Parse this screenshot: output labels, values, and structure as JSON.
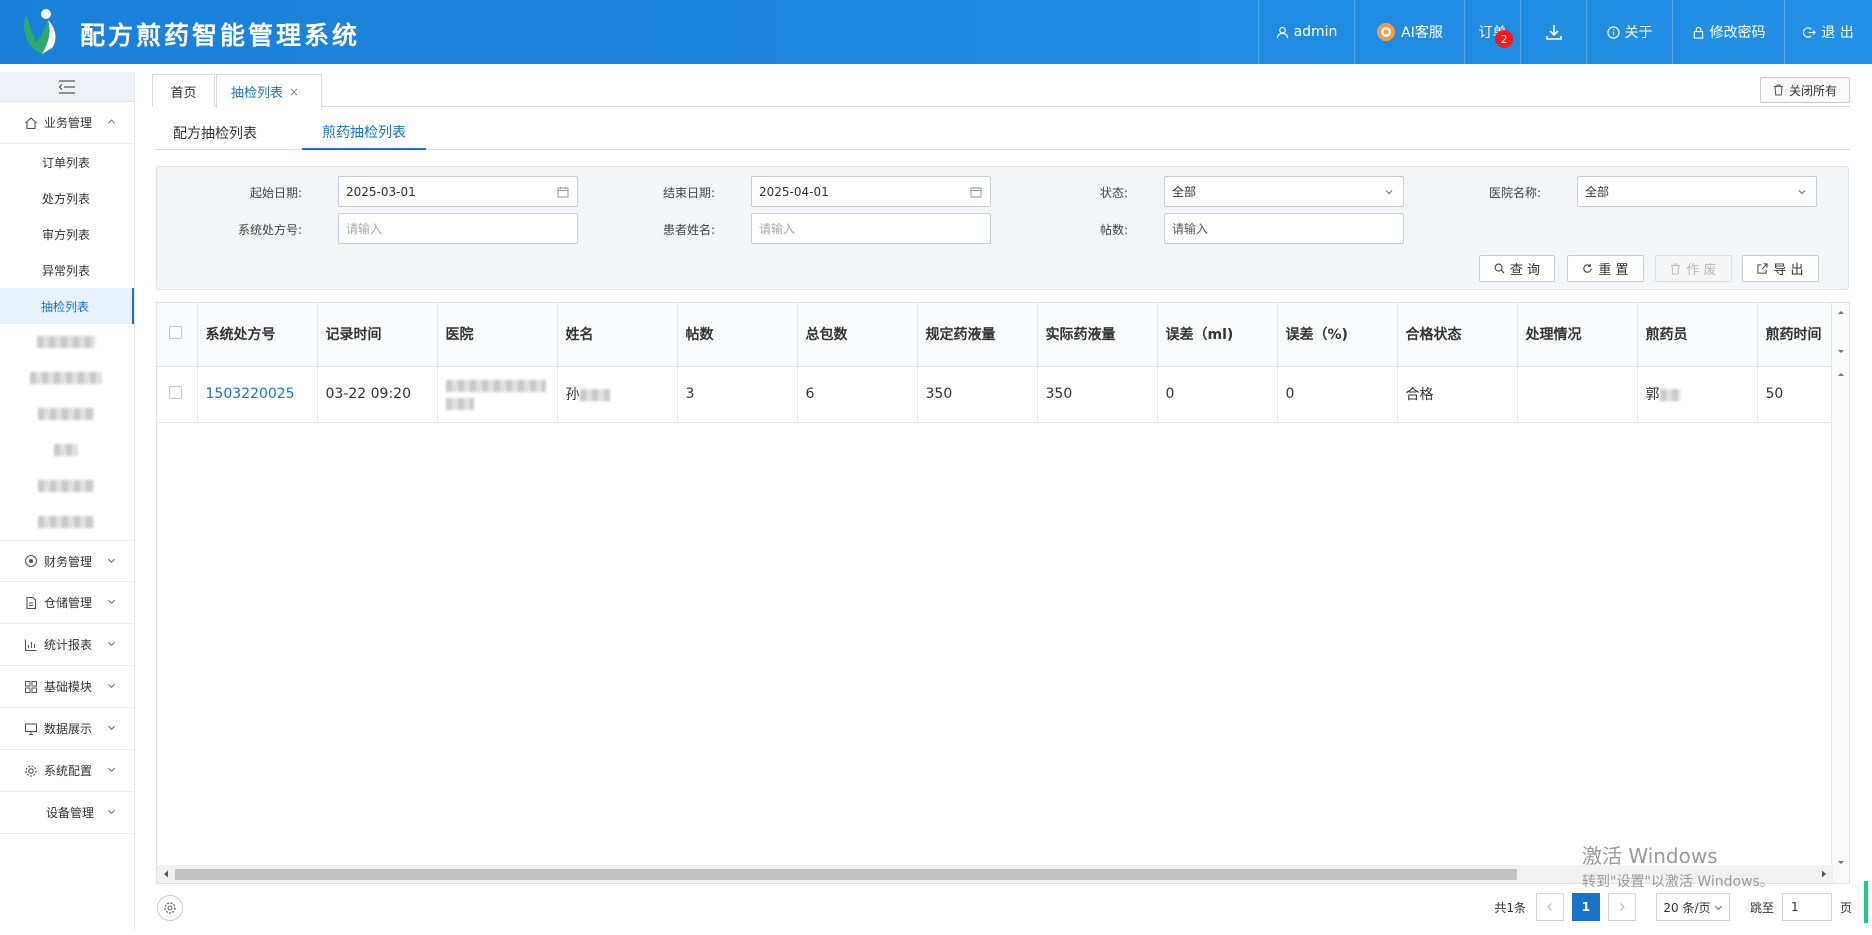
{
  "app": {
    "title": "配方煎药智能管理系统"
  },
  "header_nav": {
    "user": "admin",
    "ai_service": "AI客服",
    "orders": "订单",
    "orders_badge": "2",
    "about": "关于",
    "change_password": "修改密码",
    "logout": "退 出"
  },
  "sidebar": {
    "groups": [
      {
        "label": "业务管理",
        "icon": "home-icon",
        "expanded": true
      },
      {
        "label": "财务管理",
        "icon": "finance-icon"
      },
      {
        "label": "仓储管理",
        "icon": "storage-icon"
      },
      {
        "label": "统计报表",
        "icon": "chart-icon"
      },
      {
        "label": "基础模块",
        "icon": "module-icon"
      },
      {
        "label": "数据展示",
        "icon": "monitor-icon"
      },
      {
        "label": "系统配置",
        "icon": "gear-icon"
      },
      {
        "label": "设备管理",
        "icon": ""
      }
    ],
    "items": [
      {
        "label": "订单列表"
      },
      {
        "label": "处方列表"
      },
      {
        "label": "审方列表"
      },
      {
        "label": "异常列表"
      },
      {
        "label": "抽检列表",
        "active": true
      }
    ]
  },
  "page_tabs": [
    {
      "label": "首页"
    },
    {
      "label": "抽检列表",
      "active": true,
      "close": "×"
    }
  ],
  "close_all": "关闭所有",
  "sub_tabs": [
    {
      "label": "配方抽检列表"
    },
    {
      "label": "煎药抽检列表",
      "active": true
    }
  ],
  "filters": {
    "start_date": {
      "label": "起始日期:",
      "value": "2025-03-01"
    },
    "end_date": {
      "label": "结束日期:",
      "value": "2025-04-01"
    },
    "status": {
      "label": "状态:",
      "value": "全部"
    },
    "hospital": {
      "label": "医院名称:",
      "value": "全部"
    },
    "rx_no": {
      "label": "系统处方号:",
      "placeholder": "请输入"
    },
    "patient": {
      "label": "患者姓名:",
      "placeholder": "请输入"
    },
    "doses": {
      "label": "帖数:",
      "placeholder": "请输入"
    }
  },
  "buttons": {
    "search": "查 询",
    "reset": "重 置",
    "void": "作 废",
    "export": "导 出"
  },
  "table": {
    "columns": [
      "系统处方号",
      "记录时间",
      "医院",
      "姓名",
      "帖数",
      "总包数",
      "规定药液量",
      "实际药液量",
      "误差（ml)",
      "误差（%)",
      "合格状态",
      "处理情况",
      "煎药员",
      "煎药时间"
    ],
    "rows": [
      {
        "rx_no": "1503220025",
        "time": "03-22 09:20",
        "name_prefix": "孙",
        "doses": "3",
        "packs": "6",
        "required": "350",
        "actual": "350",
        "err_ml": "0",
        "err_pct": "0",
        "status": "合格",
        "handling": "",
        "staff_prefix": "郭",
        "decoct_time": "50"
      }
    ]
  },
  "pager": {
    "total": "共1条",
    "current": "1",
    "size": "20 条/页",
    "jump_label": "跳至",
    "jump_value": "1",
    "page_suffix": "页"
  },
  "watermark": {
    "line1": "激活 Windows",
    "line2": "转到\"设置\"以激活 Windows。"
  },
  "colors": {
    "header": "#1a7fd8",
    "accent": "#1a73c6",
    "badge": "#ee1c1c"
  }
}
